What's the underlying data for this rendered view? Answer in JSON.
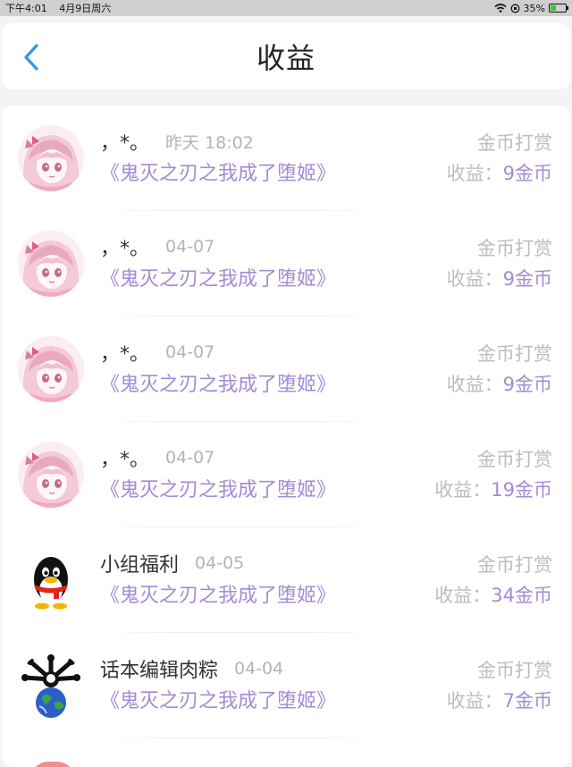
{
  "status": {
    "time": "下午4:01",
    "date": "4月9日周六",
    "battery": "35%",
    "battery_level": 0.35
  },
  "header": {
    "title": "收益"
  },
  "rows": [
    {
      "name": "，*。",
      "time": "昨天 18:02",
      "book": "《鬼灭之刃之我成了堕姬》",
      "kind": "金币打赏",
      "earn_label": "收益：",
      "earn_value": "9金币",
      "avatar": "anime-girl-avatar"
    },
    {
      "name": "，*。",
      "time": "04-07",
      "book": "《鬼灭之刃之我成了堕姬》",
      "kind": "金币打赏",
      "earn_label": "收益：",
      "earn_value": "9金币",
      "avatar": "anime-girl-avatar"
    },
    {
      "name": "，*。",
      "time": "04-07",
      "book": "《鬼灭之刃之我成了堕姬》",
      "kind": "金币打赏",
      "earn_label": "收益：",
      "earn_value": "9金币",
      "avatar": "anime-girl-avatar"
    },
    {
      "name": "，*。",
      "time": "04-07",
      "book": "《鬼灭之刃之我成了堕姬》",
      "kind": "金币打赏",
      "earn_label": "收益：",
      "earn_value": "19金币",
      "avatar": "anime-girl-avatar"
    },
    {
      "name": "小组福利",
      "time": "04-05",
      "book": "《鬼灭之刃之我成了堕姬》",
      "kind": "金币打赏",
      "earn_label": "收益：",
      "earn_value": "34金币",
      "avatar": "penguin-avatar"
    },
    {
      "name": "话本编辑肉粽",
      "time": "04-04",
      "book": "《鬼灭之刃之我成了堕姬》",
      "kind": "金币打赏",
      "earn_label": "收益：",
      "earn_value": "7金币",
      "avatar": "globe-creature-avatar"
    }
  ],
  "colors": {
    "accent_purple": "#a58ad6",
    "back_blue": "#2f95e8",
    "muted_gray": "#bdbdbd"
  }
}
